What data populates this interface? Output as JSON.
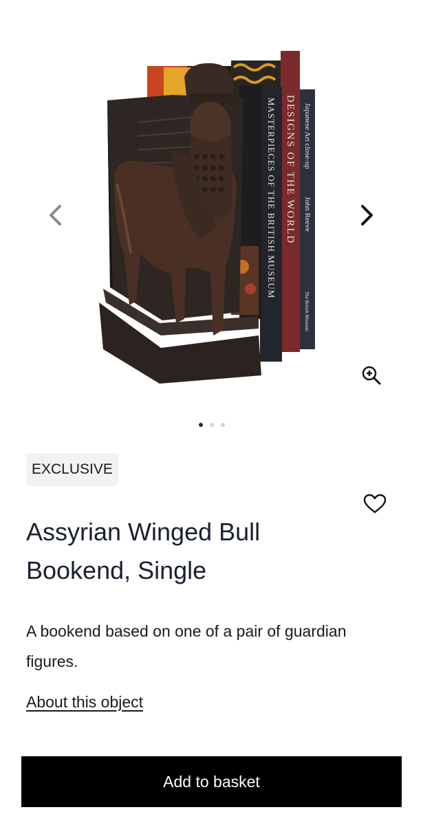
{
  "gallery": {
    "image_alt": "Assyrian Winged Bull Bookend with books",
    "books": {
      "spine_1": "MASTERPIECES OF THE BRITISH MUSEUM",
      "spine_2": "DESIGNS OF THE WORLD",
      "spine_3_title": "Japanese Art close-up",
      "spine_3_author": "John Reeve",
      "spine_3_publisher": "The British Museum"
    },
    "slide_count": 3,
    "active_slide": 1
  },
  "product": {
    "badge": "EXCLUSIVE",
    "title_line1": "Assyrian Winged Bull",
    "title_line2": "Bookend, Single",
    "description": "A bookend based on one of a pair of guardian figures.",
    "about_link": "About this object",
    "add_to_basket": "Add to basket"
  },
  "colors": {
    "button_bg": "#000000",
    "badge_bg": "#f2f2f2",
    "text": "#1a2030"
  },
  "icons": {
    "prev": "chevron-left-icon",
    "next": "chevron-right-icon",
    "zoom": "zoom-in-icon",
    "wishlist": "heart-outline-icon"
  }
}
